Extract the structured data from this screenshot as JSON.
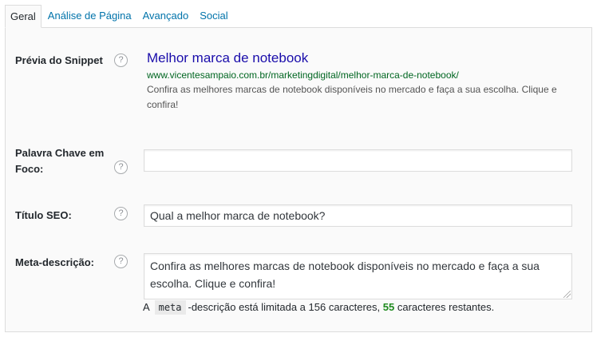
{
  "tabs": [
    {
      "label": "Geral",
      "active": true
    },
    {
      "label": "Análise de Página",
      "active": false
    },
    {
      "label": "Avançado",
      "active": false
    },
    {
      "label": "Social",
      "active": false
    }
  ],
  "help_glyph": "?",
  "snippet": {
    "label": "Prévia do Snippet",
    "title": "Melhor marca de notebook",
    "url": "www.vicentesampaio.com.br/marketingdigital/melhor-marca-de-notebook/",
    "description": "Confira as melhores marcas de notebook disponíveis no mercado e faça a sua escolha. Clique e confira!"
  },
  "focus_keyword": {
    "label": "Palavra Chave em Foco:",
    "value": ""
  },
  "seo_title": {
    "label": "Título SEO:",
    "value": "Qual a melhor marca de notebook?"
  },
  "meta_description": {
    "label": "Meta-descrição:",
    "value": "Confira as melhores marcas de notebook disponíveis no mercado e faça a sua escolha. Clique e confira!",
    "note_prefix": "A",
    "note_code": "meta",
    "note_middle": "-descrição está limitada a 156 caracteres,",
    "remaining": "55",
    "note_suffix": "caracteres restantes."
  },
  "colors": {
    "link": "#0073aa",
    "snippet_title": "#1a0dab",
    "snippet_url": "#006621",
    "remaining_count": "#1e8a1e"
  },
  "icons": {
    "help": "help-circle-icon",
    "resize": "resize-grip-icon"
  }
}
